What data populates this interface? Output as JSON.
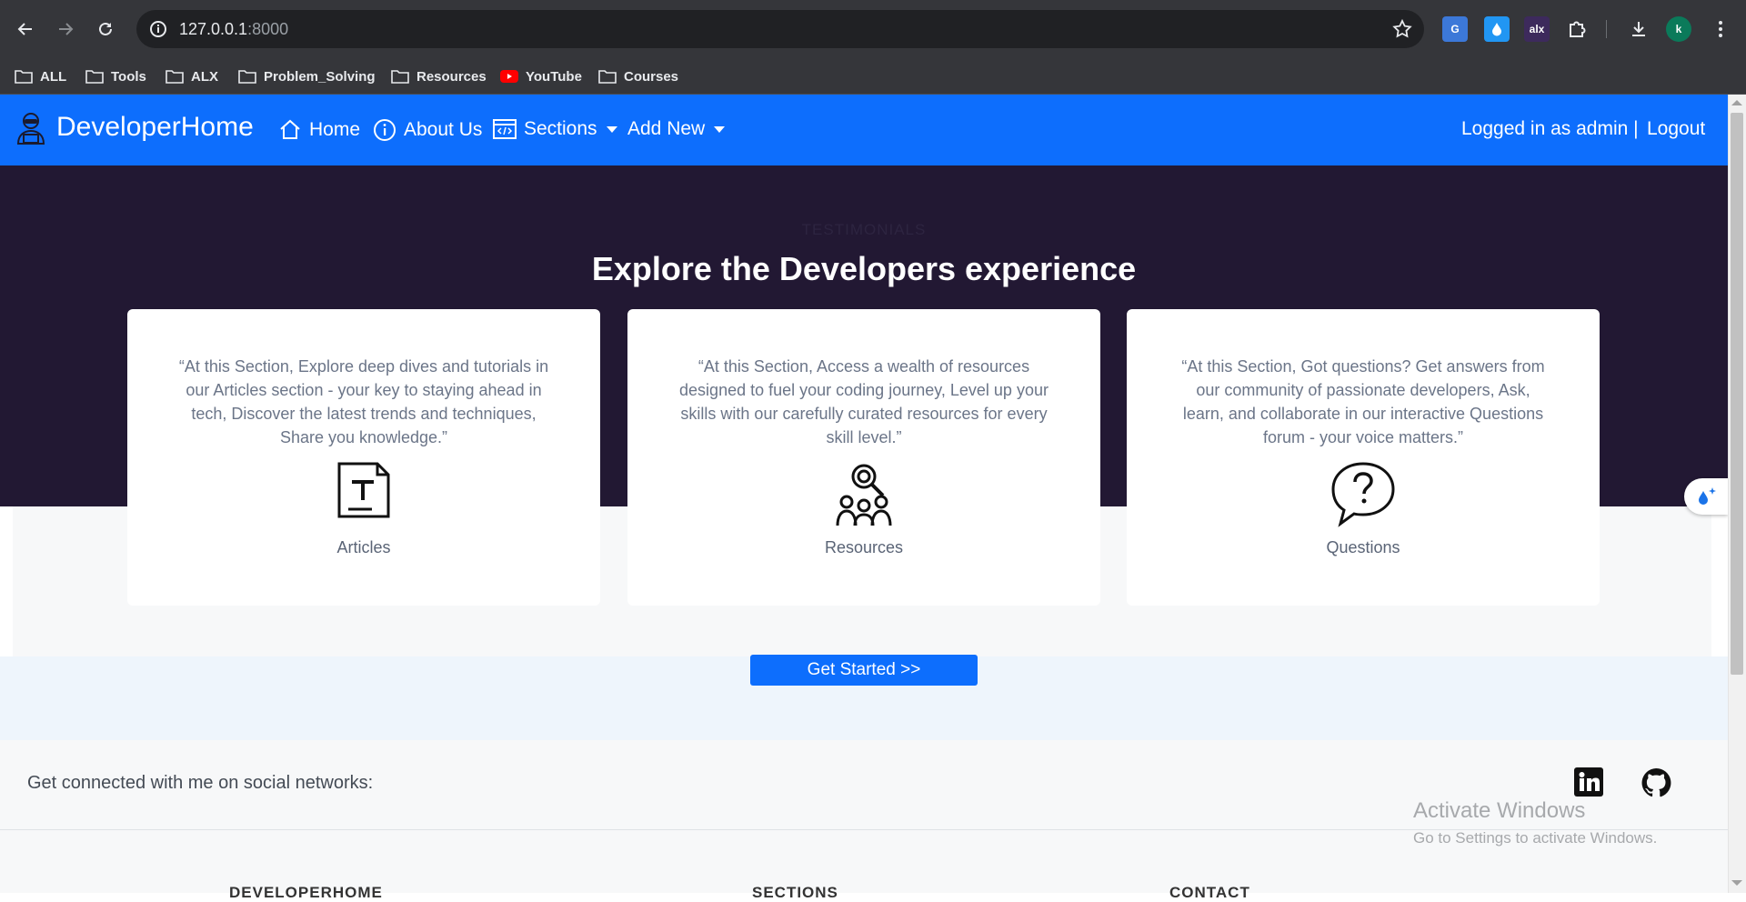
{
  "browser": {
    "url_host": "127.0.0.1",
    "url_port": ":8000",
    "profile_initial": "k",
    "bookmarks": [
      "ALL",
      "Tools",
      "ALX",
      "Problem_Solving",
      "Resources",
      "YouTube",
      "Courses"
    ],
    "ext_alx_label": "alx"
  },
  "navbar": {
    "brand": "DeveloperHome",
    "home": "Home",
    "about": "About Us",
    "sections": "Sections",
    "add_new": "Add New",
    "logged_in": "Logged in as admin |",
    "logout": "Logout"
  },
  "hero": {
    "eyebrow": "TESTIMONIALS",
    "title": "Explore the Developers experience",
    "cards": [
      {
        "quote": "“At this Section, Explore deep dives and tutorials in our Articles section - your key to staying ahead in tech, Discover the latest trends and techniques, Share you knowledge.”",
        "caption": "Articles",
        "icon": "article-icon"
      },
      {
        "quote": "“At this Section, Access a wealth of resources designed to fuel your coding journey, Level up your skills with our carefully curated resources for every skill level.”",
        "caption": "Resources",
        "icon": "resources-icon"
      },
      {
        "quote": "“At this Section, Got questions? Get answers from our community of passionate developers, Ask, learn, and collaborate in our interactive Questions forum - your voice matters.”",
        "caption": "Questions",
        "icon": "question-icon"
      }
    ],
    "cta": "Get Started >>"
  },
  "footer": {
    "social_text": "Get connected with me on social networks:",
    "col1": "DEVELOPERHOME",
    "col2": "SECTIONS",
    "col3": "CONTACT"
  },
  "os": {
    "activate_title": "Activate Windows",
    "activate_sub": "Go to Settings to activate Windows."
  },
  "colors": {
    "primary": "#0d6efd",
    "hero_bg": "#221833",
    "chrome": "#35363a"
  }
}
